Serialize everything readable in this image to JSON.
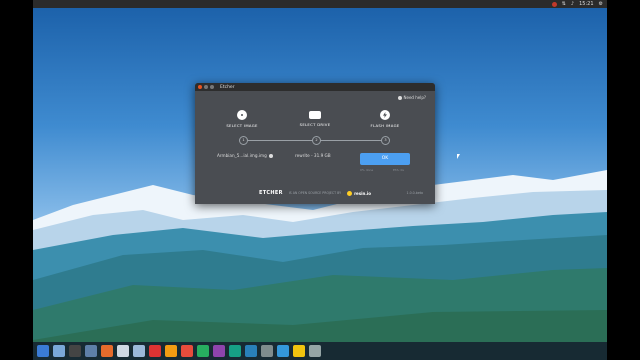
{
  "topbar": {
    "clock": "15:21"
  },
  "window": {
    "title": "Etcher",
    "help_label": "Need help?",
    "steps": [
      {
        "label": "SELECT IMAGE",
        "number": "1",
        "value": "Armbian_5...ial.img.img",
        "icon": "disc-icon"
      },
      {
        "label": "SELECT DRIVE",
        "number": "2",
        "value": "rewrite - 31.9 GB",
        "icon": "drive-icon"
      },
      {
        "label": "FLASH IMAGE",
        "number": "3",
        "icon": "flash-icon"
      }
    ],
    "flash_button": "OK",
    "flash_sub_left": "0% done",
    "flash_sub_right": "ETA: 0s",
    "footer": {
      "logo": "ETCHER",
      "tagline": "IS AN OPEN SOURCE PROJECT BY",
      "brand": "resin.io",
      "version": "1.0.0-beta"
    }
  },
  "dock": {
    "icons": [
      "menu-icon",
      "files-icon",
      "terminal-icon",
      "settings-icon",
      "browser-icon",
      "text-editor-icon",
      "image-viewer-icon",
      "app-icon-8",
      "app-icon-9",
      "app-icon-10",
      "app-icon-11",
      "app-icon-12",
      "app-icon-13",
      "app-icon-14",
      "app-icon-15",
      "app-icon-16",
      "app-icon-17",
      "app-icon-18"
    ]
  },
  "colors": {
    "accent": "#4c9ff1",
    "window_bg": "#4a4d52"
  }
}
